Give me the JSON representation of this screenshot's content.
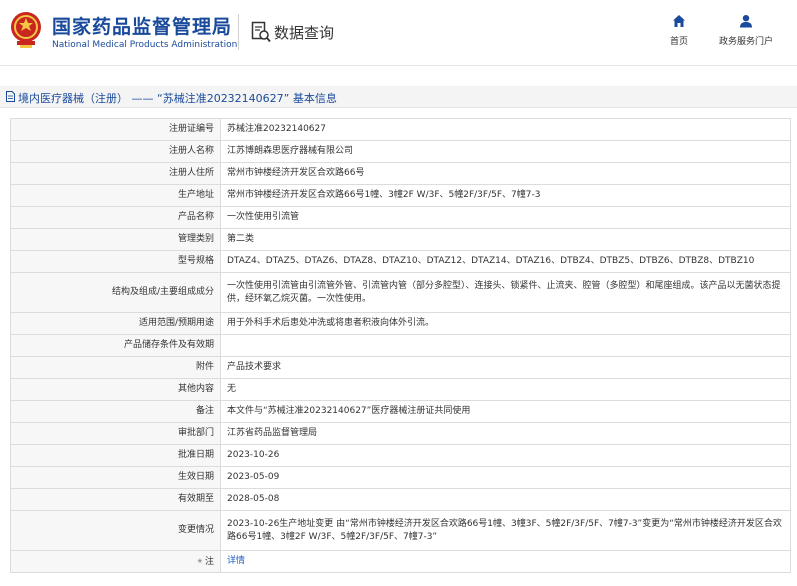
{
  "header": {
    "brand_cn": "国家药品监督管理局",
    "brand_en": "National Medical Products Administration",
    "query_title": "数据查询",
    "logo_icon": "national-emblem-icon",
    "query_icon": "document-search-icon"
  },
  "nav": {
    "home_label": "首页",
    "portal_label": "政务服务门户",
    "home_icon": "home-icon",
    "portal_icon": "user-icon"
  },
  "breadcrumb": {
    "icon": "document-icon",
    "text": "境内医疗器械（注册） —— “苏械注准20232140627” 基本信息"
  },
  "colors": {
    "brand_blue": "#1a4a9c",
    "link_blue": "#1a5cc8",
    "label_bg": "#f7f7f7",
    "border": "#dcdcdc"
  },
  "rows": [
    {
      "label": "注册证编号",
      "value": "苏械注准20232140627"
    },
    {
      "label": "注册人名称",
      "value": "江苏博朗森思医疗器械有限公司"
    },
    {
      "label": "注册人住所",
      "value": "常州市钟楼经济开发区合欢路66号"
    },
    {
      "label": "生产地址",
      "value": "常州市钟楼经济开发区合欢路66号1幢、3幢2F W/3F、5幢2F/3F/5F、7幢7-3"
    },
    {
      "label": "产品名称",
      "value": "一次性使用引流管"
    },
    {
      "label": "管理类别",
      "value": "第二类"
    },
    {
      "label": "型号规格",
      "value": "DTAZ4、DTAZ5、DTAZ6、DTAZ8、DTAZ10、DTAZ12、DTAZ14、DTAZ16、DTBZ4、DTBZ5、DTBZ6、DTBZ8、DTBZ10"
    },
    {
      "label": "结构及组成/主要组成成分",
      "value": "一次性使用引流管由引流管外管、引流管内管（部分多腔型）、连接头、锁紧件、止流夹、腔管（多腔型）和尾座组成。该产品以无菌状态提供，经环氧乙烷灭菌。一次性使用。"
    },
    {
      "label": "适用范围/预期用途",
      "value": "用于外科手术后患处冲洗或将患者积液向体外引流。"
    },
    {
      "label": "产品储存条件及有效期",
      "value": ""
    },
    {
      "label": "附件",
      "value": "产品技术要求"
    },
    {
      "label": "其他内容",
      "value": "无"
    },
    {
      "label": "备注",
      "value": "本文件与“苏械注准20232140627”医疗器械注册证共同使用"
    },
    {
      "label": "审批部门",
      "value": "江苏省药品监督管理局"
    },
    {
      "label": "批准日期",
      "value": "2023-10-26"
    },
    {
      "label": "生效日期",
      "value": "2023-05-09"
    },
    {
      "label": "有效期至",
      "value": "2028-05-08"
    },
    {
      "label": "变更情况",
      "value": "2023-10-26生产地址变更 由“常州市钟楼经济开发区合欢路66号1幢、3幢3F、5幢2F/3F/5F、7幢7-3”变更为“常州市钟楼经济开发区合欢路66号1幢、3幢2F W/3F、5幢2F/3F/5F、7幢7-3”"
    },
    {
      "label": "注",
      "value": "详情",
      "star": "★"
    }
  ]
}
